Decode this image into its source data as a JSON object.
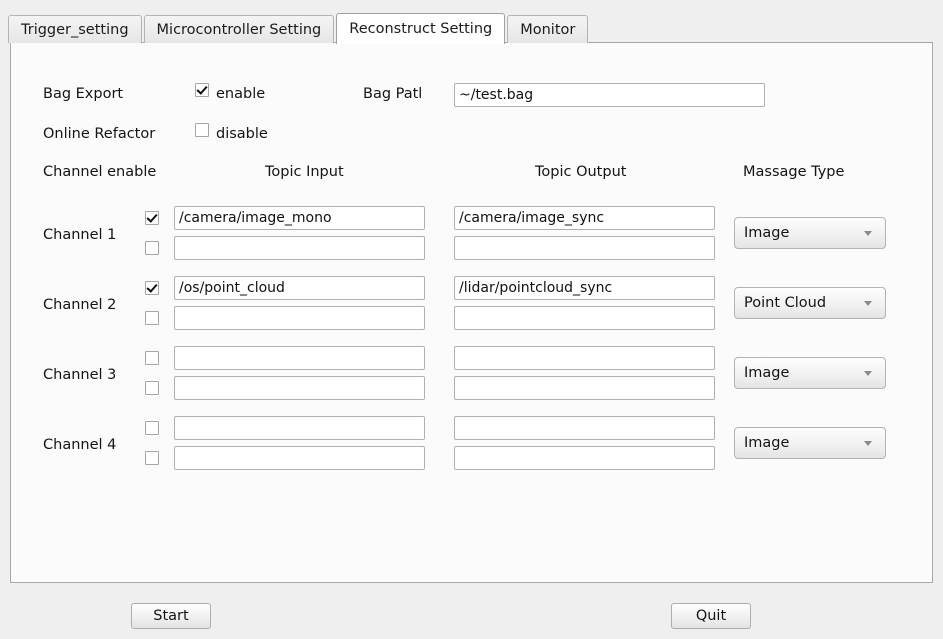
{
  "tabs": [
    {
      "label": "Trigger_setting",
      "active": false
    },
    {
      "label": "Microcontroller Setting",
      "active": false
    },
    {
      "label": "Reconstruct Setting",
      "active": true
    },
    {
      "label": "Monitor",
      "active": false
    }
  ],
  "form": {
    "bag_export_label": "Bag Export",
    "bag_export_checkbox_label": "enable",
    "bag_export_checked": true,
    "online_refactor_label": "Online Refactor",
    "online_refactor_checkbox_label": "disable",
    "online_refactor_checked": false,
    "bag_path_label": "Bag Patl",
    "bag_path_value": "~/test.bag"
  },
  "headers": {
    "channel_enable": "Channel enable",
    "topic_input": "Topic Input",
    "topic_output": "Topic Output",
    "message_type": "Massage Type"
  },
  "channels": [
    {
      "label": "Channel 1",
      "message_type": "Image",
      "rows": [
        {
          "enabled": true,
          "topic_input": "/camera/image_mono",
          "topic_output": "/camera/image_sync"
        },
        {
          "enabled": false,
          "topic_input": "",
          "topic_output": ""
        }
      ]
    },
    {
      "label": "Channel 2",
      "message_type": "Point Cloud",
      "rows": [
        {
          "enabled": true,
          "topic_input": "/os/point_cloud",
          "topic_output": "/lidar/pointcloud_sync"
        },
        {
          "enabled": false,
          "topic_input": "",
          "topic_output": ""
        }
      ]
    },
    {
      "label": "Channel 3",
      "message_type": "Image",
      "rows": [
        {
          "enabled": false,
          "topic_input": "",
          "topic_output": ""
        },
        {
          "enabled": false,
          "topic_input": "",
          "topic_output": ""
        }
      ]
    },
    {
      "label": "Channel 4",
      "message_type": "Image",
      "rows": [
        {
          "enabled": false,
          "topic_input": "",
          "topic_output": ""
        },
        {
          "enabled": false,
          "topic_input": "",
          "topic_output": ""
        }
      ]
    }
  ],
  "footer": {
    "start_label": "Start",
    "quit_label": "Quit"
  }
}
